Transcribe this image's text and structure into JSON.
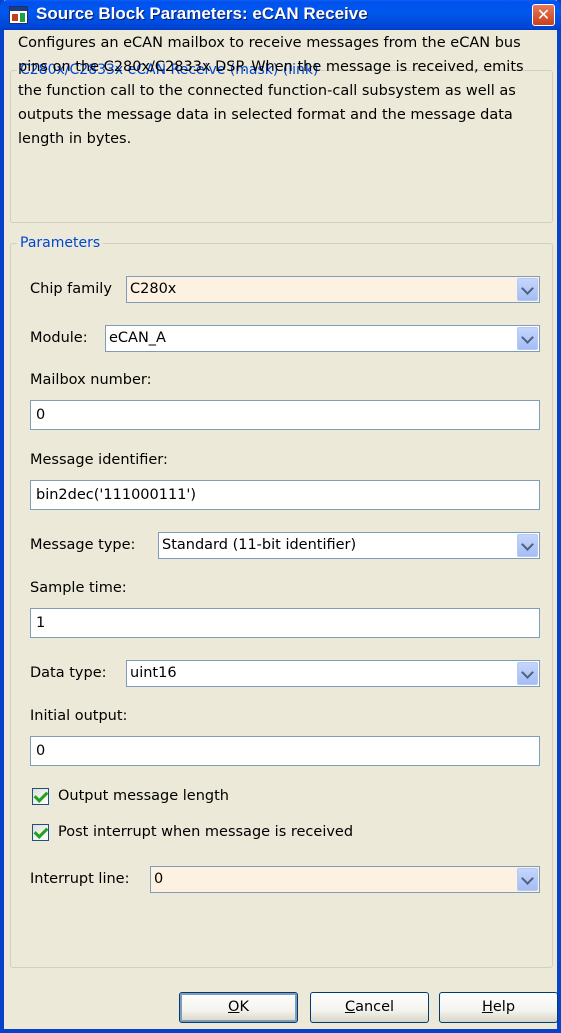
{
  "window": {
    "title": "Source Block Parameters: eCAN Receive",
    "close_glyph": "✕"
  },
  "description": {
    "legend": "C280x/C2833x eCAN Receive (mask) (link)",
    "text": "Configures an eCAN mailbox to receive messages from the eCAN bus pins on the C280x/C2833x DSP. When the message is received, emits the function call to the connected function-call subsystem as well as outputs the message data in selected format and the message data length in bytes."
  },
  "parameters": {
    "legend": "Parameters",
    "chip_family": {
      "label": "Chip family",
      "value": "C280x"
    },
    "module": {
      "label": "Module:",
      "value": "eCAN_A"
    },
    "mailbox_number": {
      "label": "Mailbox number:",
      "value": "0"
    },
    "message_identifier": {
      "label": "Message identifier:",
      "value": "bin2dec('111000111')"
    },
    "message_type": {
      "label": "Message type:",
      "value": "Standard (11-bit identifier)"
    },
    "sample_time": {
      "label": "Sample time:",
      "value": "1"
    },
    "data_type": {
      "label": "Data type:",
      "value": "uint16"
    },
    "initial_output": {
      "label": "Initial output:",
      "value": "0"
    },
    "output_message_length": {
      "label": "Output message length",
      "checked": true
    },
    "post_interrupt": {
      "label": "Post interrupt when message is received",
      "checked": true
    },
    "interrupt_line": {
      "label": "Interrupt line:",
      "value": "0"
    }
  },
  "buttons": {
    "ok": {
      "mnemonic": "O",
      "rest": "K"
    },
    "cancel": {
      "mnemonic": "C",
      "rest": "ancel"
    },
    "help": {
      "mnemonic": "H",
      "rest": "elp"
    }
  },
  "icons": {
    "app": "simulink-block-icon",
    "close": "close-icon",
    "dropdown": "chevron-down-icon",
    "check": "checkmark-icon"
  },
  "colors": {
    "title_bar": "#0054e3",
    "legend": "#0046d5",
    "dialog_bg": "#ece9d8",
    "tinted_field": "#fdf2e1",
    "check": "#21a121"
  }
}
